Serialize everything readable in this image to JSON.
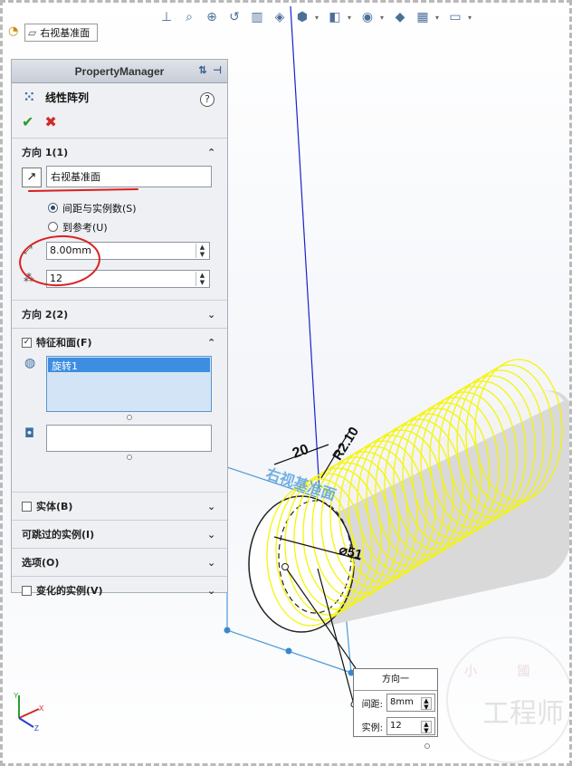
{
  "breadcrumb": {
    "item": "右视基准面"
  },
  "property_manager": {
    "header": "PropertyManager",
    "title": "线性阵列",
    "direction1": {
      "label": "方向 1(1)",
      "reference": "右视基准面",
      "options": [
        {
          "label": "间距与实例数(S)",
          "selected": true
        },
        {
          "label": "到参考(U)",
          "selected": false
        }
      ],
      "spacing": "8.00mm",
      "instances": "12"
    },
    "direction2": {
      "label": "方向 2(2)"
    },
    "features": {
      "label": "特征和面(F)",
      "checked": true,
      "items": [
        "旋转1"
      ]
    },
    "sections": [
      {
        "label": "实体(B)",
        "checkbox": true
      },
      {
        "label": "可跳过的实例(I)",
        "checkbox": false
      },
      {
        "label": "选项(O)",
        "checkbox": false
      },
      {
        "label": "变化的实例(V)",
        "checkbox": true
      }
    ]
  },
  "viewport": {
    "plane_label": "右视基准面",
    "dim_20": "20",
    "dim_r": "R2.10",
    "dim_dia": "⌀51"
  },
  "callout": {
    "title": "方向一",
    "spacing_label": "间距:",
    "spacing_value": "8mm",
    "count_label": "实例:",
    "count_value": "12"
  },
  "watermark": {
    "line1": "小 國",
    "line2": "工程师"
  },
  "colors": {
    "coil": "#f5f50a",
    "plane": "#4c9ad6",
    "axis": "#1a22cc",
    "annotation": "#d9201f"
  }
}
